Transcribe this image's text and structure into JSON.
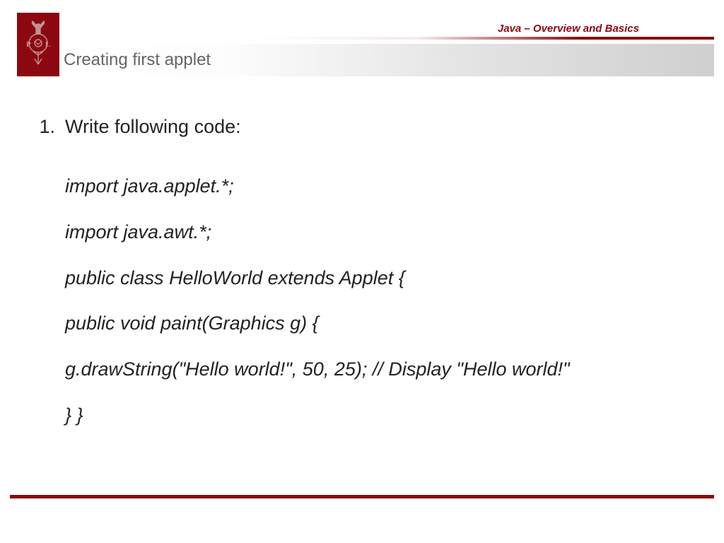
{
  "header": {
    "course_label": "Java – Overview and Basics",
    "slide_title": "Creating first applet"
  },
  "list": {
    "number": "1.",
    "prompt": "Write following code:"
  },
  "code": {
    "lines": [
      "import java.applet.*;",
      "import java.awt.*;",
      "public class HelloWorld extends Applet {",
      "public void paint(Graphics g) {",
      "g.drawString(\"Hello world!\", 50, 25); // Display \"Hello world!\"",
      "} }"
    ]
  }
}
